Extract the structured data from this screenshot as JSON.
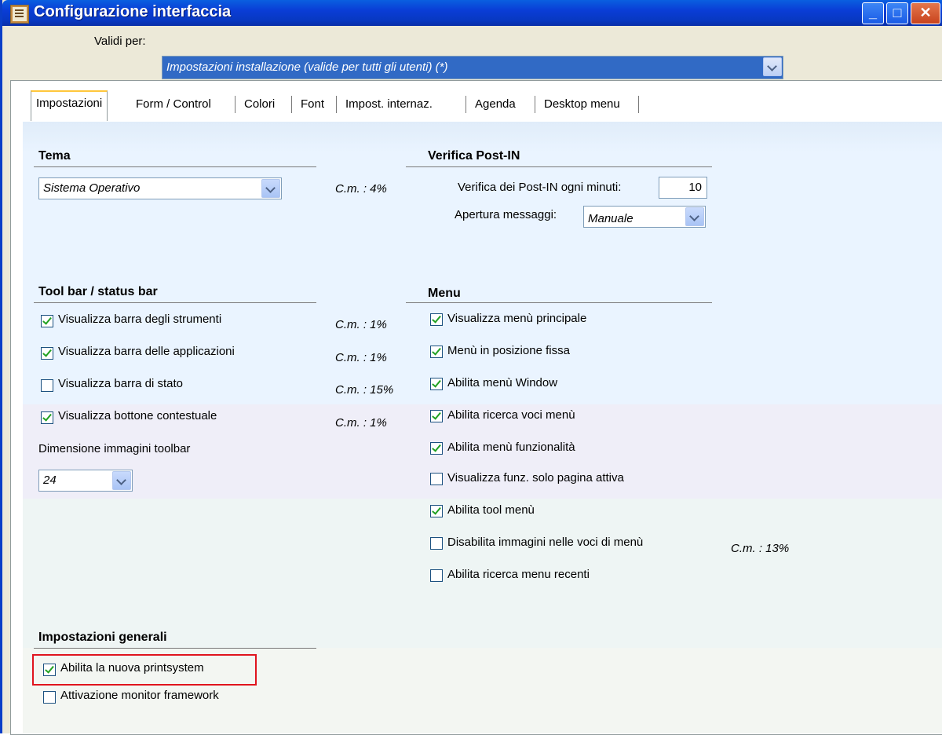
{
  "window": {
    "title": "Configurazione interfaccia",
    "controls": {
      "minimize": "_",
      "maximize": "□",
      "close": "✕"
    }
  },
  "valid_for": {
    "label": "Validi per:",
    "value": "Impostazioni installazione (valide per tutti gli utenti) (*)"
  },
  "tabs": [
    {
      "label": "Impostazioni"
    },
    {
      "label": "Form / Control"
    },
    {
      "label": "Colori"
    },
    {
      "label": "Font"
    },
    {
      "label": "Impost. internaz."
    },
    {
      "label": "Agenda"
    },
    {
      "label": "Desktop menu"
    }
  ],
  "tema": {
    "title": "Tema",
    "value": "Sistema Operativo",
    "cm": "C.m. : 4%"
  },
  "postin": {
    "title": "Verifica Post-IN",
    "minutes_label": "Verifica dei Post-IN ogni minuti:",
    "minutes_value": "10",
    "open_label": "Apertura messaggi:",
    "open_value": "Manuale"
  },
  "toolbar": {
    "title": "Tool bar / status bar",
    "items": [
      {
        "label": "Visualizza barra degli strumenti",
        "checked": true,
        "cm": "C.m. : 1%"
      },
      {
        "label": "Visualizza barra delle applicazioni",
        "checked": true,
        "cm": "C.m. : 1%"
      },
      {
        "label": "Visualizza barra di stato",
        "checked": false,
        "cm": "C.m. : 15%"
      },
      {
        "label": "Visualizza bottone contestuale",
        "checked": true,
        "cm": "C.m. : 1%"
      }
    ],
    "size_label": "Dimensione immagini toolbar",
    "size_value": "24"
  },
  "menu": {
    "title": "Menu",
    "items": [
      {
        "label": "Visualizza menù principale",
        "checked": true
      },
      {
        "label": "Menù in posizione fissa",
        "checked": true
      },
      {
        "label": "Abilita menù Window",
        "checked": true
      },
      {
        "label": "Abilita ricerca voci menù",
        "checked": true
      },
      {
        "label": "Abilita menù funzionalità",
        "checked": true
      },
      {
        "label": "Visualizza funz. solo pagina attiva",
        "checked": false
      },
      {
        "label": "Abilita tool menù",
        "checked": true
      },
      {
        "label": "Disabilita immagini nelle voci di menù",
        "checked": false
      },
      {
        "label": "Abilita ricerca menu recenti",
        "checked": false
      }
    ],
    "cm": "C.m. : 13%"
  },
  "general": {
    "title": "Impostazioni generali",
    "items": [
      {
        "label": "Abilita la nuova printsystem",
        "checked": true
      },
      {
        "label": "Attivazione monitor framework",
        "checked": false
      }
    ]
  },
  "colors": {
    "titlebar": "#0a3dd6",
    "selection": "#316ac5",
    "highlight_box": "#e0141e",
    "check": "#21a121"
  }
}
